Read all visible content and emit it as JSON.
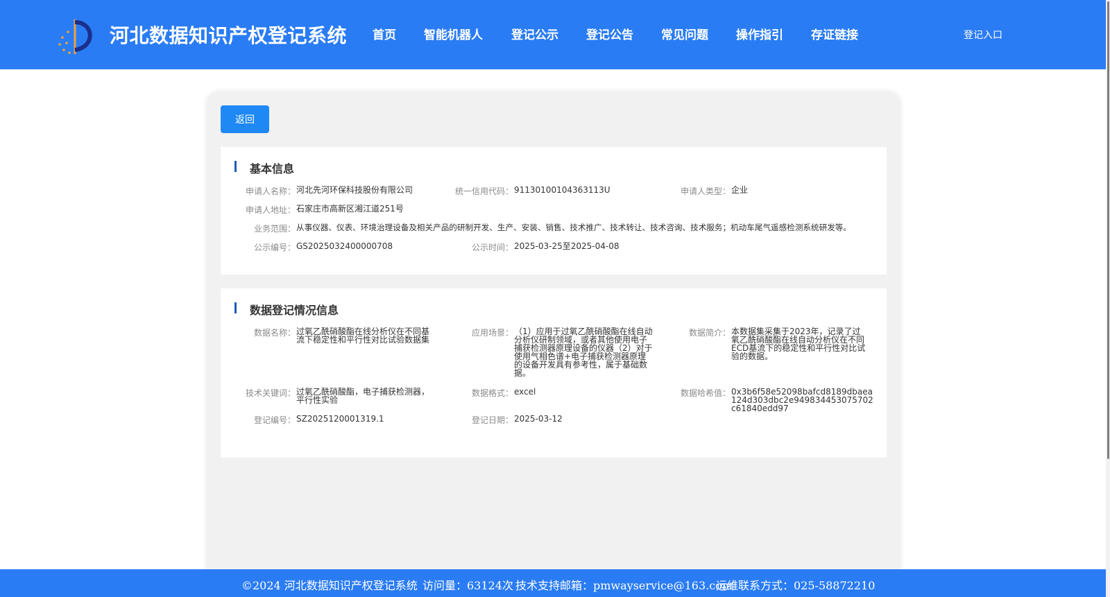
{
  "header": {
    "title": "河北数据知识产权登记系统",
    "nav": [
      "首页",
      "智能机器人",
      "登记公示",
      "登记公告",
      "常见问题",
      "操作指引",
      "存证链接"
    ],
    "login": "登记入口"
  },
  "back_label": "返回",
  "basic_info": {
    "title": "基本信息",
    "applicant_name": {
      "label": "申请人名称：",
      "value": "河北先河环保科技股份有限公司"
    },
    "credit_code": {
      "label": "统一信用代码：",
      "value": "91130100104363113U"
    },
    "applicant_type": {
      "label": "申请人类型：",
      "value": "企业"
    },
    "address": {
      "label": "申请人地址：",
      "value": "石家庄市高新区湘江道251号"
    },
    "business_scope": {
      "label": "业务范围：",
      "value": "从事仪器、仪表、环境治理设备及相关产品的研制开发、生产、安装、销售、技术推广、技术转让、技术咨询、技术服务；机动车尾气遥感检测系统研发等。"
    },
    "notice_no": {
      "label": "公示编号：",
      "value": "GS2025032400000708"
    },
    "notice_time": {
      "label": "公示时间：",
      "value": "2025-03-25至2025-04-08"
    }
  },
  "data_info": {
    "title": "数据登记情况信息",
    "data_name": {
      "label": "数据名称：",
      "value": "过氧乙酰硝酸酯在线分析仪在不同基流下稳定性和平行性对比试验数据集"
    },
    "scenario": {
      "label": "应用场景：",
      "value": "（1）应用于过氧乙酰硝酸酯在线自动分析仪研制领域，或者其他使用电子捕获检测器原理设备的仪器（2）对于使用气相色谱+电子捕获检测器原理的设备开发具有参考性，属于基础数据。"
    },
    "summary": {
      "label": "数据简介：",
      "value": "本数据集采集于2023年，记录了过氧乙酰硝酸酯在线自动分析仪在不同ECD基流下的稳定性和平行性对比试验的数据。"
    },
    "keywords": {
      "label": "技术关键词：",
      "value": "过氧乙酰硝酸酯，电子捕获检测器，平行性实验"
    },
    "format": {
      "label": "数据格式：",
      "value": "excel"
    },
    "hash": {
      "label": "数据哈希值：",
      "value": "0x3b6f58e52098bafcd8189dbaea124d303dbc2e949834453075702c61840edd97"
    },
    "reg_no": {
      "label": "登记编号：",
      "value": "SZ2025120001319.1"
    },
    "reg_date": {
      "label": "登记日期：",
      "value": "2025-03-12"
    }
  },
  "footer": {
    "copyright": "©2024 河北数据知识产权登记系统",
    "visits": "访问量：63124次",
    "email": "技术支持邮箱：pmwayservice@163.com",
    "phone": "运维联系方式：025-58872210"
  },
  "colors": {
    "brand_blue": "#2a7cf4",
    "button_blue": "#1e88f5",
    "section_bar": "#1a5bb8"
  },
  "icons": {
    "logo": "emblem-logo-icon"
  }
}
